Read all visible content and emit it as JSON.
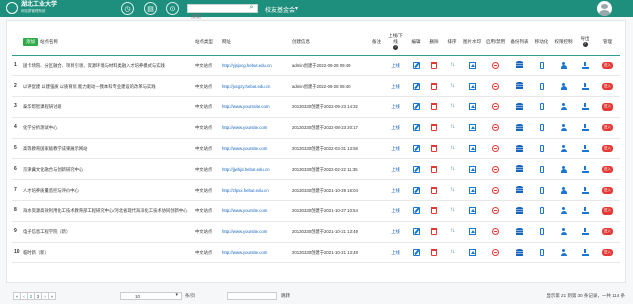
{
  "header": {
    "search_placeholder": "搜索",
    "site_name": "校友基金会",
    "site_caret": "▾",
    "logo_title": "湖北工业大学",
    "logo_subtitle": "网站群管理系统"
  },
  "table": {
    "add_label": "添加",
    "headers": {
      "site_name": "站点名称",
      "site_type": "站点类型",
      "url": "网址",
      "created": "创建信息",
      "note": "备注",
      "online": "上线/下线",
      "edit": "编辑",
      "delete": "删除",
      "sort": "排序",
      "watermark": "图片水印",
      "enable": "启用/禁用",
      "backup": "备份列表",
      "mobile": "移动化",
      "permission": "权限控制",
      "export": "导出",
      "manage": "管理"
    },
    "online_label": "上线",
    "manage_label": "进入",
    "rows": [
      {
        "num": "1",
        "name": "国卡场院、分区融合、项目引领，资源环境与材料类融入才培养模式与实践",
        "type": "中文站点",
        "url": "http://yjsjxcg.hebut.edu.cn",
        "created": "admin创建于2022-09-28 09:49"
      },
      {
        "num": "2",
        "name": "以评促建 以建强质 以质育优 能力驱动—我本科专业建设的改革与实践",
        "type": "中文站点",
        "url": "http://jxcgzy.hebut.edu.cn",
        "created": "admin创建于2022-09-28 09:40"
      },
      {
        "num": "3",
        "name": "泰华帮智课程研讨班",
        "type": "中文站点",
        "url": "http://www.yourssite.com",
        "created": "20130330创建于2022-09-23 14:32"
      },
      {
        "num": "4",
        "name": "化学分析测试中心",
        "type": "中文站点",
        "url": "http://www.yoursite.com",
        "created": "20130330创建于2022-08-23 20:17"
      },
      {
        "num": "5",
        "name": "高等教育国家级教学成果展示网站",
        "type": "中文站点",
        "url": "http://www.yoursite.com",
        "created": "20130330创建于2022-03-31 13:58"
      },
      {
        "num": "6",
        "name": "京津冀文化融合与创新研究中心",
        "type": "中文站点",
        "url": "http://jjwhjd.hebut.edu.cn",
        "created": "20130330创建于2022-02-22 11:35"
      },
      {
        "num": "7",
        "name": "人才培养质量监控与评价中心",
        "type": "中文站点",
        "url": "http://zlpxx.hebut.edu.cn",
        "created": "20130330创建于2021-10-29 16:04"
      },
      {
        "num": "8",
        "name": "海水资源高效利用化工技术教育部工程研究中心/河北省现代海洋化工技术协同创新中心",
        "type": "中文站点",
        "url": "http://www.yoursite.com",
        "created": "20130330创建于2021-10-27 10:54"
      },
      {
        "num": "9",
        "name": "电子信息工程学院（新）",
        "type": "中文站点",
        "url": "http://www.yoursite.com",
        "created": "20130330创建于2021-10-21 13:49"
      },
      {
        "num": "10",
        "name": "临时新（新）",
        "type": "中文站点",
        "url": "http://www.yoursite.com",
        "created": "20130330创建于2021-10-21 13:48"
      }
    ]
  },
  "footer": {
    "pager": [
      "«",
      "‹",
      "2",
      "3",
      "›",
      "»"
    ],
    "active_page": "2",
    "page_size": "10",
    "per_page_label": "条/页",
    "jump_label": "跳转",
    "summary": "显示第 21 到第 30 条记录，一共 114 条"
  }
}
